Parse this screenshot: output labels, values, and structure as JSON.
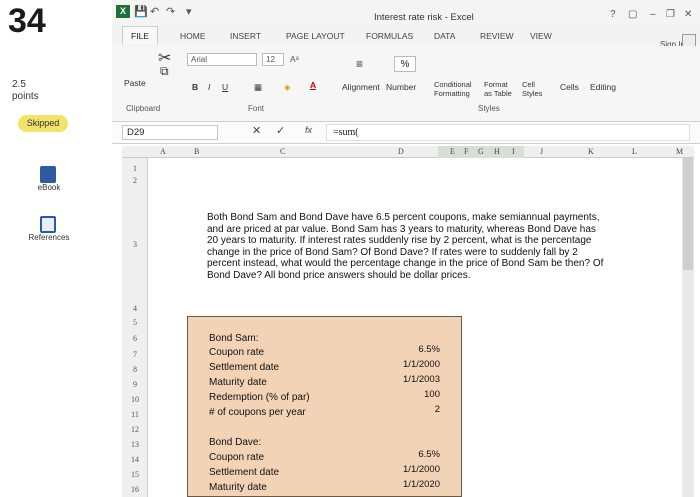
{
  "sidebar": {
    "question_number": "34",
    "points": "2.5\npoints",
    "status": "Skipped",
    "ebook_label": "eBook",
    "references_label": "References"
  },
  "window": {
    "title": "Interest rate risk - Excel",
    "sign_in": "Sign In"
  },
  "tabs": [
    "FILE",
    "HOME",
    "INSERT",
    "PAGE LAYOUT",
    "FORMULAS",
    "DATA",
    "REVIEW",
    "VIEW"
  ],
  "ribbon": {
    "paste_label": "Paste",
    "font_name": "Arial",
    "font_size": "12",
    "bold": "B",
    "italic": "I",
    "underline": "U",
    "percent": "%",
    "alignment": "Alignment",
    "number": "Number",
    "conditional_formatting": "Conditional Formatting",
    "format_as_table": "Format as Table",
    "cell_styles": "Cell Styles",
    "cells": "Cells",
    "editing": "Editing",
    "group_clipboard": "Clipboard",
    "group_font": "Font",
    "group_styles": "Styles"
  },
  "formula_bar": {
    "name_box": "D29",
    "fx": "fx",
    "formula": "=sum("
  },
  "columns": [
    "A",
    "B",
    "C",
    "D",
    "E",
    "F",
    "G",
    "H",
    "I",
    "J",
    "K",
    "L",
    "M"
  ],
  "rows": [
    "1",
    "2",
    "3",
    "4",
    "5",
    "6",
    "7",
    "8",
    "9",
    "10",
    "11",
    "12",
    "13",
    "14",
    "15",
    "16"
  ],
  "problem_text": "Both Bond Sam and Bond Dave have 6.5 percent coupons, make semiannual payments, and are priced at par value. Bond Sam has 3 years to maturity, whereas Bond Dave has 20 years to maturity. If interest rates suddenly rise by 2 percent, what is the percentage change in the price of Bond Sam? Of Bond Dave? If rates were to suddenly fall by 2 percent instead, what would the percentage change in the price of Bond Sam be then? Of Bond Dave? All bond price answers should be dollar prices.",
  "bond_sam": {
    "heading": "Bond Sam:",
    "rows": [
      {
        "label": "Coupon rate",
        "value": "6.5%"
      },
      {
        "label": "Settlement date",
        "value": "1/1/2000"
      },
      {
        "label": "Maturity date",
        "value": "1/1/2003"
      },
      {
        "label": "Redemption (% of par)",
        "value": "100"
      },
      {
        "label": "# of coupons per year",
        "value": "2"
      }
    ]
  },
  "bond_dave": {
    "heading": "Bond Dave:",
    "rows": [
      {
        "label": "Coupon rate",
        "value": "6.5%"
      },
      {
        "label": "Settlement date",
        "value": "1/1/2000"
      },
      {
        "label": "Maturity date",
        "value": "1/1/2020"
      }
    ]
  },
  "colors": {
    "excel_green": "#1e6f3a",
    "skipped_badge": "#f2e36a",
    "input_box": "#f3d3b6",
    "value_text": "#111111"
  }
}
